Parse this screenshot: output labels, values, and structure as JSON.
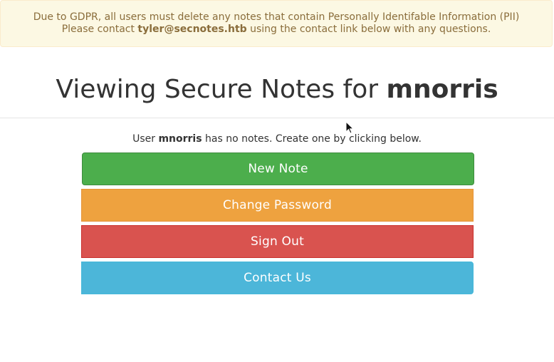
{
  "alert": {
    "line1": "Due to GDPR, all users must delete any notes that contain Personally Identifable Information (PII)",
    "line2_prefix": "Please contact ",
    "line2_email": "tyler@secnotes.htb",
    "line2_suffix": " using the contact link below with any questions."
  },
  "header": {
    "title_prefix": "Viewing Secure Notes for ",
    "username": "mnorris"
  },
  "notes": {
    "msg_prefix": "User ",
    "username": "mnorris",
    "msg_suffix": " has no notes. Create one by clicking below."
  },
  "buttons": {
    "new_note": "New Note",
    "change_password": "Change Password",
    "sign_out": "Sign Out",
    "contact_us": "Contact Us"
  },
  "colors": {
    "success": "#4cae4c",
    "warning": "#eea23f",
    "danger": "#d9534f",
    "info": "#4cb6d9",
    "alert_bg": "#fcf8e3",
    "alert_text": "#8a6d3b"
  },
  "icons": {
    "cursor": "mouse-pointer-icon"
  }
}
